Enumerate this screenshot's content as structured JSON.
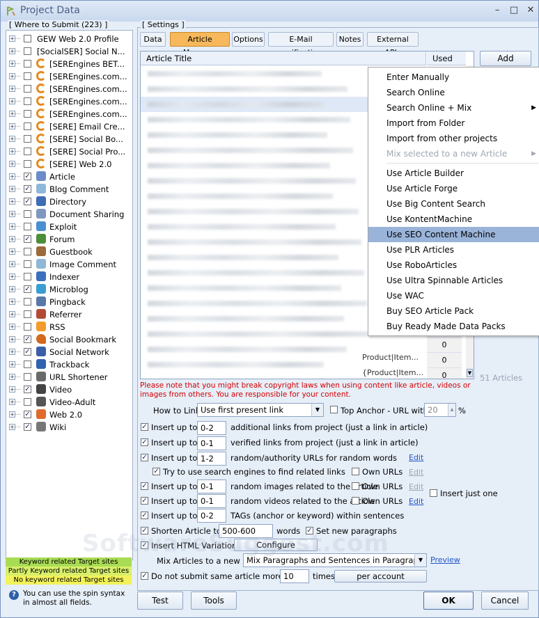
{
  "window": {
    "title": "Project Data",
    "controls": [
      "–",
      "□",
      "✕"
    ]
  },
  "left": {
    "group_label": "[ Where to Submit  (223) ]",
    "tree": [
      {
        "label": "GEW Web 2.0 Profile",
        "checked": false,
        "icon": "none-icon",
        "expander": "+"
      },
      {
        "label": "[SocialSER] Social N...",
        "checked": false,
        "icon": "none-icon",
        "expander": "+"
      },
      {
        "label": "[SEREngines BET...",
        "checked": false,
        "icon": "serengines-icon",
        "expander": "+"
      },
      {
        "label": "[SEREngines.com...",
        "checked": false,
        "icon": "serengines-icon",
        "expander": "+"
      },
      {
        "label": "[SEREngines.com...",
        "checked": false,
        "icon": "serengines-icon",
        "expander": "+"
      },
      {
        "label": "[SEREngines.com...",
        "checked": false,
        "icon": "serengines-icon",
        "expander": "+"
      },
      {
        "label": "[SEREngines.com...",
        "checked": false,
        "icon": "serengines-icon",
        "expander": "+"
      },
      {
        "label": "[SERE] Email Cre...",
        "checked": false,
        "icon": "serengines-icon",
        "expander": "+"
      },
      {
        "label": "[SERE] Social Bo...",
        "checked": false,
        "icon": "serengines-icon",
        "expander": "+"
      },
      {
        "label": "[SERE] Social Pro...",
        "checked": false,
        "icon": "serengines-icon",
        "expander": "+"
      },
      {
        "label": "[SERE] Web 2.0",
        "checked": false,
        "icon": "serengines-icon",
        "expander": "+"
      },
      {
        "label": "Article",
        "checked": true,
        "icon": "article-icon",
        "expander": "+"
      },
      {
        "label": "Blog Comment",
        "checked": true,
        "icon": "comment-icon",
        "expander": "+"
      },
      {
        "label": "Directory",
        "checked": true,
        "icon": "directory-icon",
        "expander": "+"
      },
      {
        "label": "Document Sharing",
        "checked": false,
        "icon": "document-icon",
        "expander": "+"
      },
      {
        "label": "Exploit",
        "checked": false,
        "icon": "exploit-icon",
        "expander": "+"
      },
      {
        "label": "Forum",
        "checked": true,
        "icon": "forum-icon",
        "expander": "+"
      },
      {
        "label": "Guestbook",
        "checked": false,
        "icon": "guestbook-icon",
        "expander": "+"
      },
      {
        "label": "Image Comment",
        "checked": false,
        "icon": "image-comment-icon",
        "expander": "+"
      },
      {
        "label": "Indexer",
        "checked": false,
        "icon": "indexer-icon",
        "expander": "+"
      },
      {
        "label": "Microblog",
        "checked": true,
        "icon": "microblog-icon",
        "expander": "+"
      },
      {
        "label": "Pingback",
        "checked": false,
        "icon": "pingback-icon",
        "expander": "+"
      },
      {
        "label": "Referrer",
        "checked": false,
        "icon": "referrer-icon",
        "expander": "+"
      },
      {
        "label": "RSS",
        "checked": false,
        "icon": "rss-icon",
        "expander": "+"
      },
      {
        "label": "Social Bookmark",
        "checked": true,
        "icon": "heart-icon",
        "expander": "+"
      },
      {
        "label": "Social Network",
        "checked": true,
        "icon": "social-network-icon",
        "expander": "+"
      },
      {
        "label": "Trackback",
        "checked": false,
        "icon": "trackback-icon",
        "expander": "+"
      },
      {
        "label": "URL Shortener",
        "checked": false,
        "icon": "url-shortener-icon",
        "expander": "+"
      },
      {
        "label": "Video",
        "checked": true,
        "icon": "video-icon",
        "expander": "+"
      },
      {
        "label": "Video-Adult",
        "checked": false,
        "icon": "video-adult-icon",
        "expander": "+"
      },
      {
        "label": "Web 2.0",
        "checked": true,
        "icon": "web20-icon",
        "expander": "+"
      },
      {
        "label": "Wiki",
        "checked": true,
        "icon": "wiki-icon",
        "expander": "+"
      }
    ],
    "legend": [
      {
        "label": "Keyword related Target sites",
        "color": "#a9dc55"
      },
      {
        "label": "Partly Keyword related Target sites",
        "color": "#d7ef6a"
      },
      {
        "label": "No keyword related Target sites",
        "color": "#f2f25a"
      }
    ],
    "hint": "You can use the spin syntax in almost all fields."
  },
  "settings": {
    "group_label": "[ Settings ]",
    "tabs": [
      {
        "label": "Data",
        "active": false
      },
      {
        "label": "Article Manager",
        "active": true
      },
      {
        "label": "Options",
        "active": false
      },
      {
        "label": "E-Mail verification",
        "active": false
      },
      {
        "label": "Notes",
        "active": false
      },
      {
        "label": "External APIs",
        "active": false
      }
    ],
    "grid": {
      "col_title": "Article Title",
      "col_used": "Used",
      "used_values": [
        "0",
        "0",
        "0",
        "0"
      ],
      "visible_fragments": [
        "Product|Item...",
        "{Product|Item..."
      ]
    },
    "add_button": "Add",
    "article_count": "51 Articles",
    "warning": "Please note that you might break copyright laws when using content like article, videos or images from others. You are responsible for your content."
  },
  "menu": {
    "items": [
      {
        "label": "Enter Manually",
        "submenu": false,
        "disabled": false,
        "highlight": false
      },
      {
        "label": "Search Online",
        "submenu": false,
        "disabled": false,
        "highlight": false
      },
      {
        "label": "Search Online + Mix",
        "submenu": true,
        "disabled": false,
        "highlight": false
      },
      {
        "label": "Import from Folder",
        "submenu": false,
        "disabled": false,
        "highlight": false
      },
      {
        "label": "Import from other projects",
        "submenu": false,
        "disabled": false,
        "highlight": false
      },
      {
        "label": "Mix selected to a new Article",
        "submenu": true,
        "disabled": true,
        "highlight": false
      },
      {
        "label": "Use Article Builder",
        "submenu": false,
        "disabled": false,
        "highlight": false
      },
      {
        "label": "Use Article Forge",
        "submenu": false,
        "disabled": false,
        "highlight": false
      },
      {
        "label": "Use Big Content Search",
        "submenu": false,
        "disabled": false,
        "highlight": false
      },
      {
        "label": "Use KontentMachine",
        "submenu": false,
        "disabled": false,
        "highlight": false
      },
      {
        "label": "Use SEO Content Machine",
        "submenu": false,
        "disabled": false,
        "highlight": true
      },
      {
        "label": "Use PLR Articles",
        "submenu": false,
        "disabled": false,
        "highlight": false
      },
      {
        "label": "Use RoboArticles",
        "submenu": false,
        "disabled": false,
        "highlight": false
      },
      {
        "label": "Use Ultra Spinnable Articles",
        "submenu": false,
        "disabled": false,
        "highlight": false
      },
      {
        "label": "Use WAC",
        "submenu": false,
        "disabled": false,
        "highlight": false
      },
      {
        "label": "Buy SEO Article Pack",
        "submenu": false,
        "disabled": false,
        "highlight": false
      },
      {
        "label": "Buy Ready Made Data Packs",
        "submenu": false,
        "disabled": false,
        "highlight": false
      }
    ]
  },
  "options": {
    "how_to_link_label": "How to Link",
    "how_to_link_value": "Use first present link",
    "top_anchor_label": "Top Anchor - URL with",
    "top_anchor_value": "20",
    "percent": "%",
    "insert_up_to": "Insert up to",
    "project_links_value": "0-2",
    "project_links_text": "additional links from project (just a link in article)",
    "verified_links_value": "0-1",
    "verified_links_text": "verified links from project (just a link in article)",
    "authority_value": "1-2",
    "authority_text": "random/authority URLs for random words",
    "edit": "Edit",
    "search_engines_text": "Try to use search engines to find related links",
    "own_urls": "Own URLs",
    "images_value": "0-1",
    "images_text": "random images related to the article",
    "videos_value": "0-1",
    "videos_text": "random videos related to the article",
    "insert_just_one": "Insert just one",
    "tags_value": "0-2",
    "tags_text": "TAGs (anchor or keyword) within sentences",
    "shorten_label": "Shorten Article to",
    "shorten_value": "500-600",
    "words": "words",
    "new_paragraphs": "Set new paragraphs",
    "html_variations": "Insert HTML Variations",
    "configure": "Configure",
    "mix_label": "Mix Articles to a new one",
    "mix_value": "Mix Paragraphs and Sentences in Paragraph",
    "preview": "Preview",
    "do_not_submit_label": "Do not submit same article more than",
    "do_not_submit_value": "10",
    "times": "times",
    "per_account": "per account"
  },
  "footer": {
    "test": "Test",
    "tools": "Tools",
    "ok": "OK",
    "cancel": "Cancel"
  },
  "watermark": "SoftwareSuggest.com"
}
